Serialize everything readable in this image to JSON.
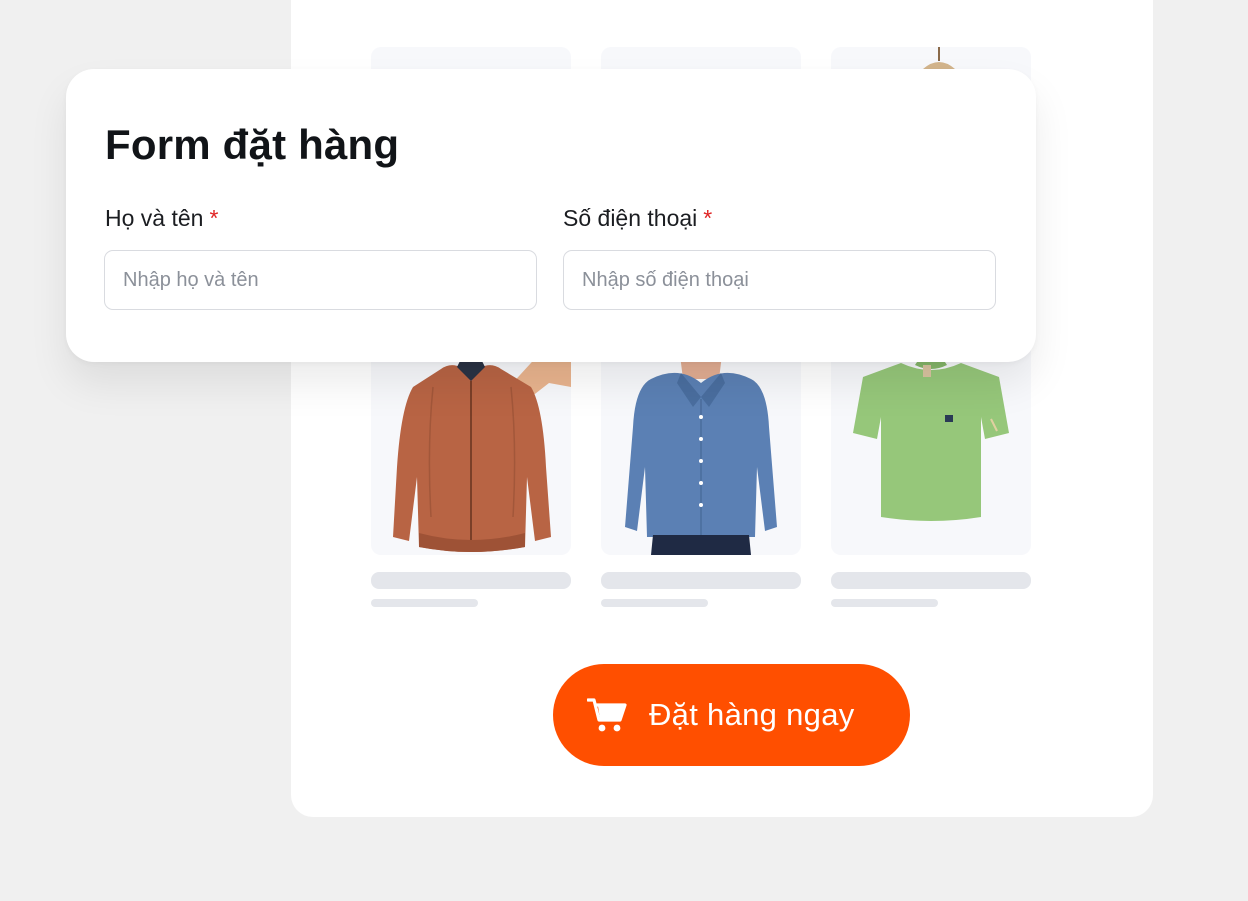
{
  "form": {
    "title": "Form đặt hàng",
    "fields": [
      {
        "label": "Họ và tên",
        "required_mark": "*",
        "placeholder": "Nhập họ và tên",
        "value": ""
      },
      {
        "label": "Số điện thoại",
        "required_mark": "*",
        "placeholder": "Nhập số điện thoại",
        "value": ""
      }
    ]
  },
  "products": [
    {
      "image": "bomber-jacket-image",
      "color": "#b86444"
    },
    {
      "image": "blue-blouse-image",
      "color": "#5b80b4"
    },
    {
      "image": "green-tshirt-image",
      "color": "#96c77a"
    }
  ],
  "cta": {
    "label": "Đặt hàng ngay",
    "icon": "cart-icon",
    "color": "#ff4f00"
  }
}
